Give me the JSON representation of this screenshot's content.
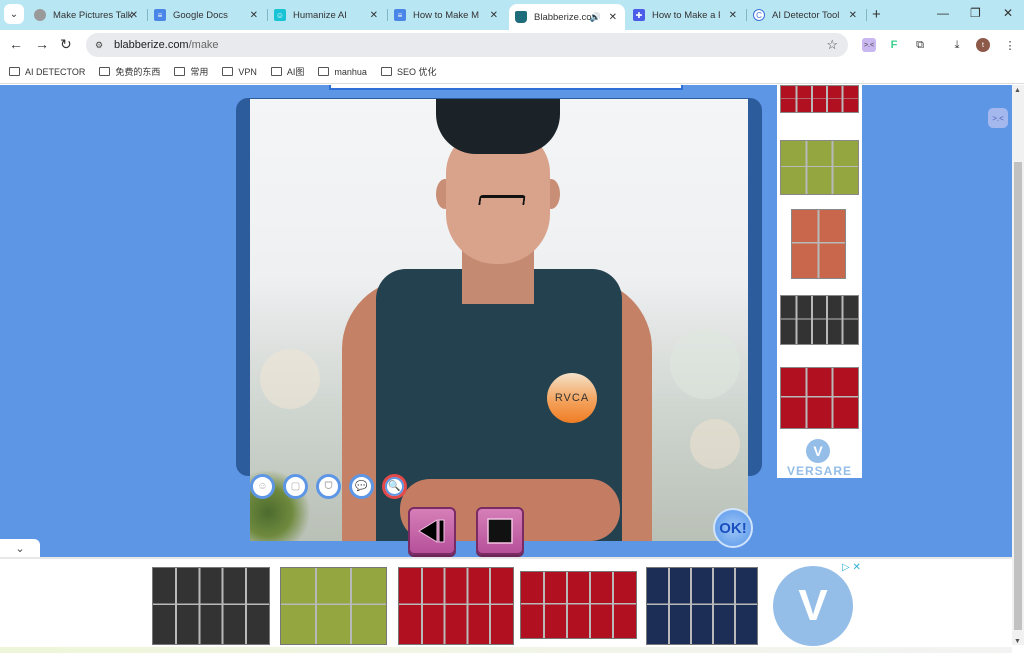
{
  "browser": {
    "tabs": [
      {
        "title": "Make Pictures Talk",
        "favicon": "gray-circle",
        "active": false
      },
      {
        "title": "Google Docs",
        "favicon": "docs",
        "active": false
      },
      {
        "title": "Humanize AI",
        "favicon": "humanize",
        "active": false
      },
      {
        "title": "How to Make My",
        "favicon": "docs",
        "active": false
      },
      {
        "title": "Blabberize.com",
        "favicon": "blabberize",
        "active": true,
        "audio": true
      },
      {
        "title": "How to Make a Ph",
        "favicon": "blue-plus",
        "active": false
      },
      {
        "title": "AI Detector Tool |",
        "favicon": "c-circle",
        "active": false
      }
    ],
    "url_domain": "blabberize.com",
    "url_path": "/make",
    "profile_initial": "t",
    "bookmarks": [
      "AI DETECTOR",
      "免费的东西",
      "常用",
      "VPN",
      "AI图",
      "manhua",
      "SEO 优化"
    ]
  },
  "editor": {
    "tools": [
      "face-tool",
      "frame-tool",
      "mouth-tool",
      "speech-bubble-tool",
      "zoom-tool"
    ],
    "selected_tool": "zoom-tool",
    "photo_logo_text": "RVCA",
    "ok_label": "OK!",
    "rewind_label": "rewind",
    "stop_label": "stop"
  },
  "ads": {
    "side_brand": "VERSARE",
    "side_brand_initial": "V",
    "bottom_brand_initial": "V",
    "side_panels": [
      {
        "color": "#b01020",
        "cols": 5
      },
      {
        "color": "#93a640",
        "cols": 3
      },
      {
        "color": "#c8674c",
        "cols": 2
      },
      {
        "color": "#333333",
        "cols": 5
      },
      {
        "color": "#b01020",
        "cols": 3
      }
    ],
    "bottom_panels": [
      {
        "color": "#333333",
        "cols": 5
      },
      {
        "color": "#93a640",
        "cols": 3
      },
      {
        "color": "#b01020",
        "cols": 5
      },
      {
        "color": "#b01020",
        "cols": 5
      },
      {
        "color": "#1c2e55",
        "cols": 5
      }
    ]
  },
  "colors": {
    "page_bg": "#5e96e6",
    "frame": "#2d5c9c",
    "control_pink": "#c868a8",
    "brand_light_blue": "#94bde8"
  }
}
